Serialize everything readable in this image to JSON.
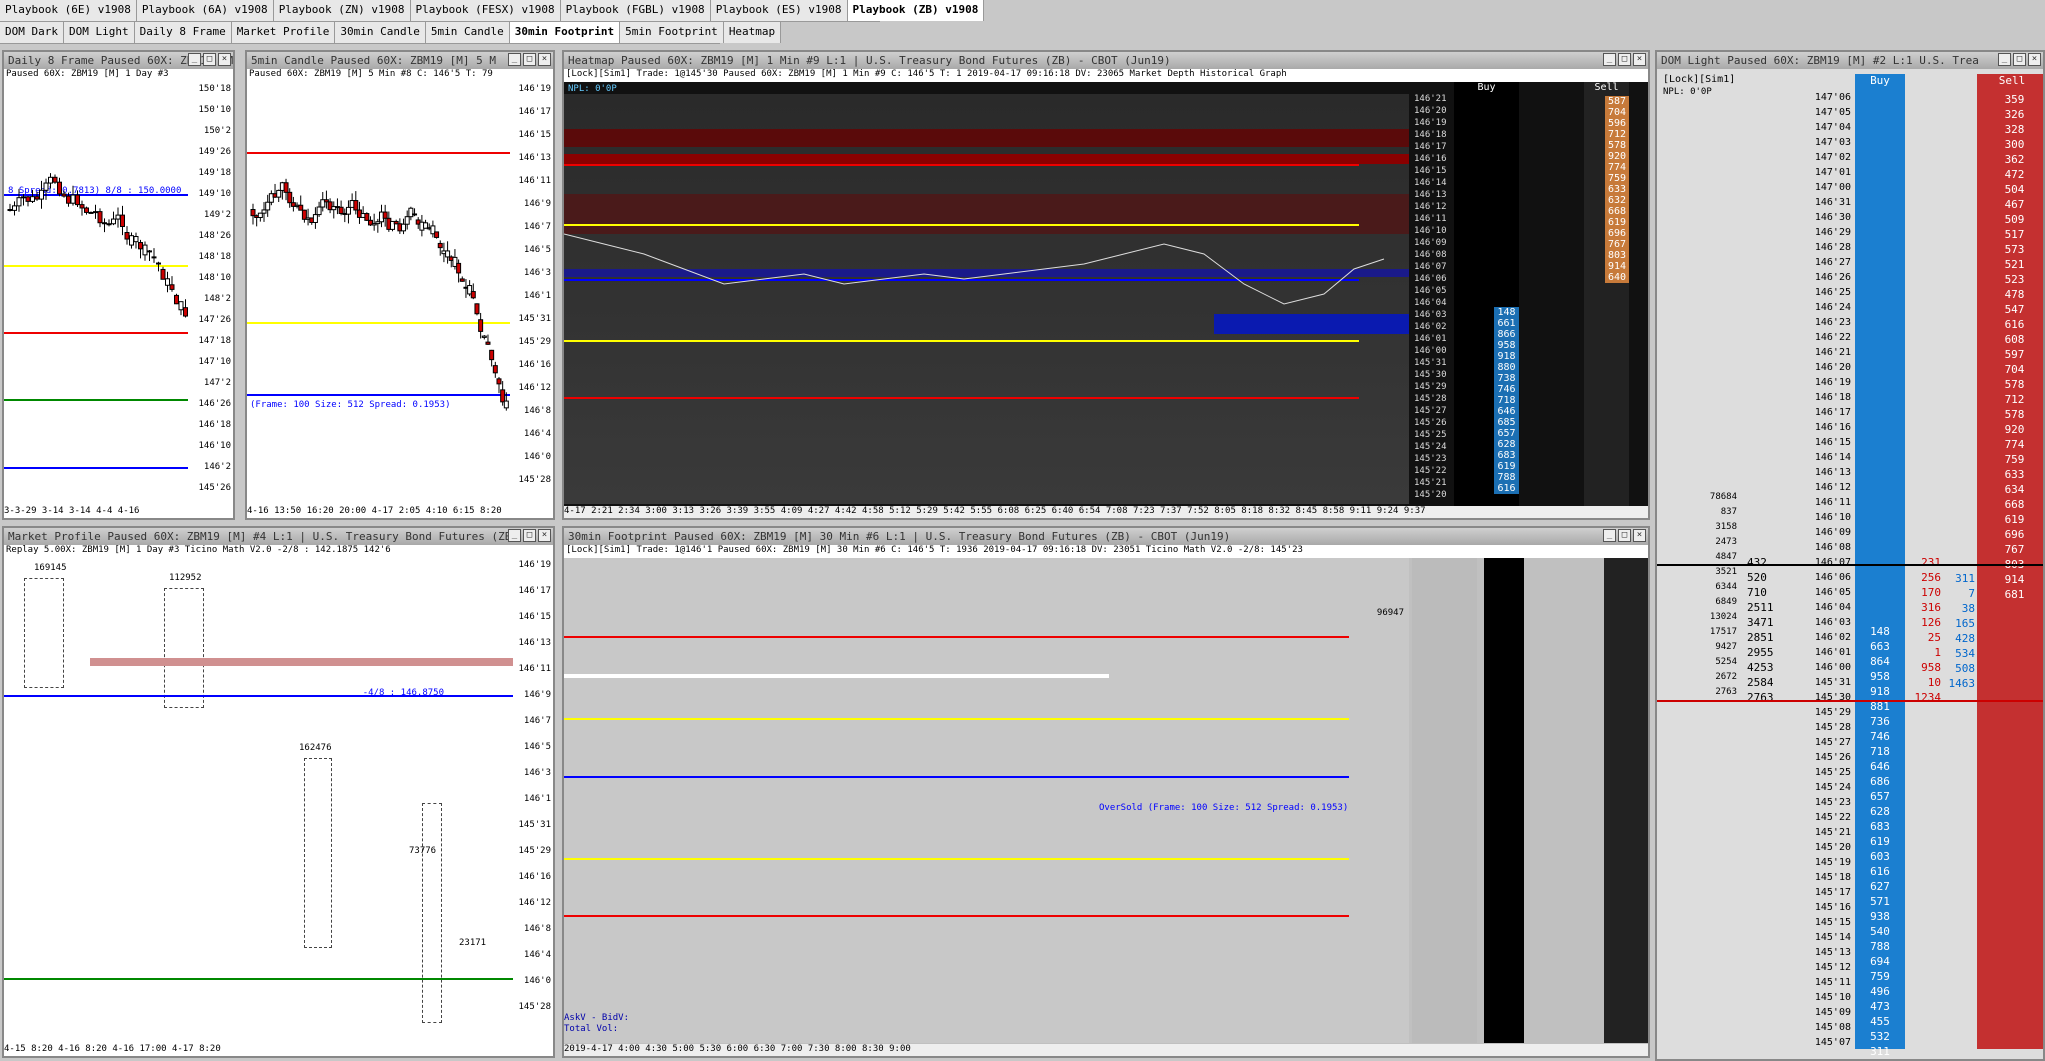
{
  "tabs_row1": [
    "Playbook (6E) v1908",
    "Playbook (6A) v1908",
    "Playbook (ZN) v1908",
    "Playbook (FESX) v1908",
    "Playbook (FGBL) v1908",
    "Playbook (ES) v1908",
    "Playbook (ZB) v1908"
  ],
  "tabs_row2": [
    "DOM Dark",
    "DOM Light",
    "Daily 8 Frame",
    "Market Profile",
    "30min Candle",
    "5min Candle",
    "30min Footprint",
    "5min Footprint",
    "Heatmap"
  ],
  "windows": {
    "daily": {
      "title": "Daily 8 Frame  Paused 60X: ZBM19 [M]  1 Day  #3",
      "info": "Paused 60X: ZBM19 [M]  1 Day   #3",
      "spread": "8 Spread: 0.7813) 8/8 : 150.0000",
      "footer": "3-3-29  3-14  3-14  4-4   4-16",
      "axis": [
        "150'18",
        "150'10",
        "150'2",
        "149'26",
        "149'18",
        "149'10",
        "149'2",
        "148'26",
        "148'18",
        "148'10",
        "148'2",
        "147'26",
        "147'18",
        "147'10",
        "147'2",
        "146'26",
        "146'18",
        "146'10",
        "146'2",
        "145'26"
      ]
    },
    "fivemin": {
      "title": "5min Candle  Paused 60X: ZBM19 [M]  5 M",
      "info": "Paused 60X: ZBM19 [M]  5 Min  #8  C: 146'5  T: 79",
      "frame": "(Frame: 100 Size: 512 Spread: 0.1953)",
      "footer": "4-16  13:50 16:20 20:00  4-17  2:05 4:10 6:15 8:20",
      "axis": [
        "146'19",
        "146'17",
        "146'15",
        "146'13",
        "146'11",
        "146'9",
        "146'7",
        "146'5",
        "146'3",
        "146'1",
        "145'31",
        "145'29",
        "146'16",
        "146'12",
        "146'8",
        "146'4",
        "146'0",
        "145'28"
      ]
    },
    "heatmap": {
      "title": "Heatmap  Paused 60X: ZBM19 [M]  1 Min  #9 L:1 | U.S. Treasury Bond Futures (ZB) - CBOT (Jun19)",
      "info": "[Lock][Sim1]  Trade: 1@145'30  Paused 60X: ZBM19 [M]  1 Min  #9  C: 146'5  T: 1  2019-04-17 09:16:18 DV: 23065 Market Depth Historical Graph",
      "npl": "NPL: 0'0P",
      "footer": "4-17  2:21 2:34 3:00 3:13 3:26 3:39 3:55 4:09 4:27 4:42 4:58 5:12 5:29 5:42 5:55 6:08 6:25 6:40 6:54 7:08 7:23 7:37 7:52 8:05 8:18 8:32 8:45 8:58 9:11 9:24 9:37"
    },
    "domlight": {
      "title": "DOM Light  Paused 60X: ZBM19 [M]  #2 L:1 U.S. Trea",
      "lock": "[Lock][Sim1]",
      "npl": "NPL: 0'0P",
      "buy": "Buy",
      "sell": "Sell"
    },
    "mprofile": {
      "title": "Market Profile  Paused 60X: ZBM19 [M]  #4 L:1 | U.S. Treasury Bond Futures (ZB)",
      "info": "Replay 5.00X: ZBM19 [M]  1 Day  #3  Ticino Math V2.0  -2/8 : 142.1875  142'6",
      "footer": "4-15  8:20   4-16  8:20    4-16  17:00    4-17  8:20",
      "line": "-4/8 : 146.8750",
      "vols": [
        "169145",
        "112952",
        "162476",
        "73776",
        "23171"
      ]
    },
    "footprint": {
      "title": "30min Footprint  Paused 60X: ZBM19 [M]  30 Min  #6 L:1 | U.S. Treasury Bond Futures (ZB) - CBOT (Jun19)",
      "info": "[Lock][Sim1]  Trade: 1@146'1  Paused 60X: ZBM19 [M]  30 Min  #6  C: 146'5  T: 1936  2019-04-17 09:16:18 DV: 23051 Ticino Math V2.0  -2/8: 145'23",
      "oversold": "OverSold (Frame: 100 Size: 512 Spread: 0.1953)",
      "total": "96947",
      "footer": "2019-4-17   4:00     4:30     5:00     5:30     6:00     6:30     7:00     7:30     8:00     8:30     9:00",
      "askbid": "AskV - BidV:",
      "totalvol": "Total Vol:"
    }
  },
  "prices_hm": [
    "146'21",
    "146'20",
    "146'19",
    "146'18",
    "146'17",
    "146'16",
    "146'15",
    "146'14",
    "146'13",
    "146'12",
    "146'11",
    "146'10",
    "146'09",
    "146'08",
    "146'07",
    "146'06",
    "146'05",
    "146'04",
    "146'03",
    "146'02",
    "146'01",
    "146'00",
    "145'31",
    "145'30",
    "145'29",
    "145'28",
    "145'27",
    "145'26",
    "145'25",
    "145'24",
    "145'23",
    "145'22",
    "145'21",
    "145'20"
  ],
  "hm_sell": [
    "587",
    "704",
    "596",
    "712",
    "578",
    "920",
    "774",
    "759",
    "633",
    "632",
    "668",
    "619",
    "696",
    "767",
    "803",
    "914",
    "640"
  ],
  "hm_buy": [
    "148",
    "661",
    "866",
    "958",
    "918",
    "880",
    "738",
    "746",
    "718",
    "646",
    "685",
    "657",
    "628",
    "683",
    "619",
    "788",
    "616"
  ],
  "dom_prices": [
    "147'06",
    "147'05",
    "147'04",
    "147'03",
    "147'02",
    "147'01",
    "147'00",
    "146'31",
    "146'30",
    "146'29",
    "146'28",
    "146'27",
    "146'26",
    "146'25",
    "146'24",
    "146'23",
    "146'22",
    "146'21",
    "146'20",
    "146'19",
    "146'18",
    "146'17",
    "146'16",
    "146'15",
    "146'14",
    "146'13",
    "146'12",
    "146'11",
    "146'10",
    "146'09",
    "146'08",
    "146'07",
    "146'06",
    "146'05",
    "146'04",
    "146'03",
    "146'02",
    "146'01",
    "146'00",
    "145'31",
    "145'30",
    "145'29",
    "145'28",
    "145'27",
    "145'26",
    "145'25",
    "145'24",
    "145'23",
    "145'22",
    "145'21",
    "145'20",
    "145'19",
    "145'18",
    "145'17",
    "145'16",
    "145'15",
    "145'14",
    "145'13",
    "145'12",
    "145'11",
    "145'10",
    "145'09",
    "145'08",
    "145'07"
  ],
  "dom_sell": [
    "359",
    "326",
    "328",
    "300",
    "362",
    "472",
    "504",
    "467",
    "509",
    "517",
    "573",
    "521",
    "523",
    "478",
    "547",
    "616",
    "608",
    "597",
    "704",
    "578",
    "712",
    "578",
    "920",
    "774",
    "759",
    "633",
    "634",
    "668",
    "619",
    "696",
    "767",
    "803",
    "914",
    "681"
  ],
  "dom_buy": [
    "148",
    "663",
    "864",
    "958",
    "918",
    "881",
    "736",
    "746",
    "718",
    "646",
    "686",
    "657",
    "628",
    "683",
    "619",
    "603",
    "616",
    "627",
    "571",
    "938",
    "540",
    "788",
    "694",
    "759",
    "496",
    "473",
    "455",
    "532",
    "311"
  ],
  "dom_vol": [
    "78684",
    "837",
    "3158",
    "2473",
    "4847",
    "3521",
    "6344",
    "6849",
    "13024",
    "17517",
    "9427",
    "5254",
    "2672",
    "2763"
  ],
  "dom_mid": [
    "432",
    "520",
    "710",
    "2511",
    "3471",
    "2851",
    "2955",
    "4253",
    "2584",
    "2763"
  ],
  "dom_orders": [
    "231",
    "256",
    "170",
    "316",
    "126",
    "25",
    "1",
    "958",
    "10",
    "1234"
  ],
  "dom_right": [
    "311",
    "7",
    "38",
    "165",
    "428",
    "534",
    "508",
    "1463"
  ]
}
